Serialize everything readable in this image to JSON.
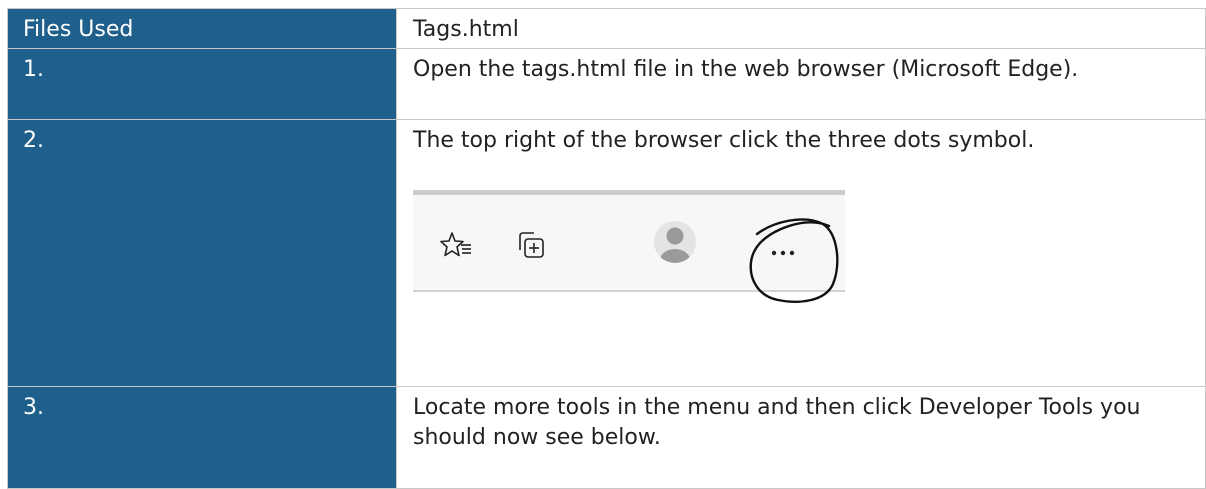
{
  "table": {
    "rows": [
      {
        "label": "Files Used",
        "content": "Tags.html"
      },
      {
        "label": "1.",
        "content": "Open the tags.html file in the web browser (Microsoft Edge)."
      },
      {
        "label": "2.",
        "content": "The top right of the browser click the three dots symbol."
      },
      {
        "label": "3.",
        "content": "Locate more tools in the menu and then click Developer Tools you should now see below."
      }
    ]
  },
  "toolbar": {
    "icons": [
      "favorites-icon",
      "collections-icon",
      "profile-avatar-icon",
      "more-options-icon"
    ],
    "more_label": "···"
  },
  "colors": {
    "label_bg": "#1f5f8b",
    "label_text": "#ffffff",
    "content_text": "#222222",
    "border": "#c9c9c9",
    "avatar": "#9a9a9a"
  }
}
